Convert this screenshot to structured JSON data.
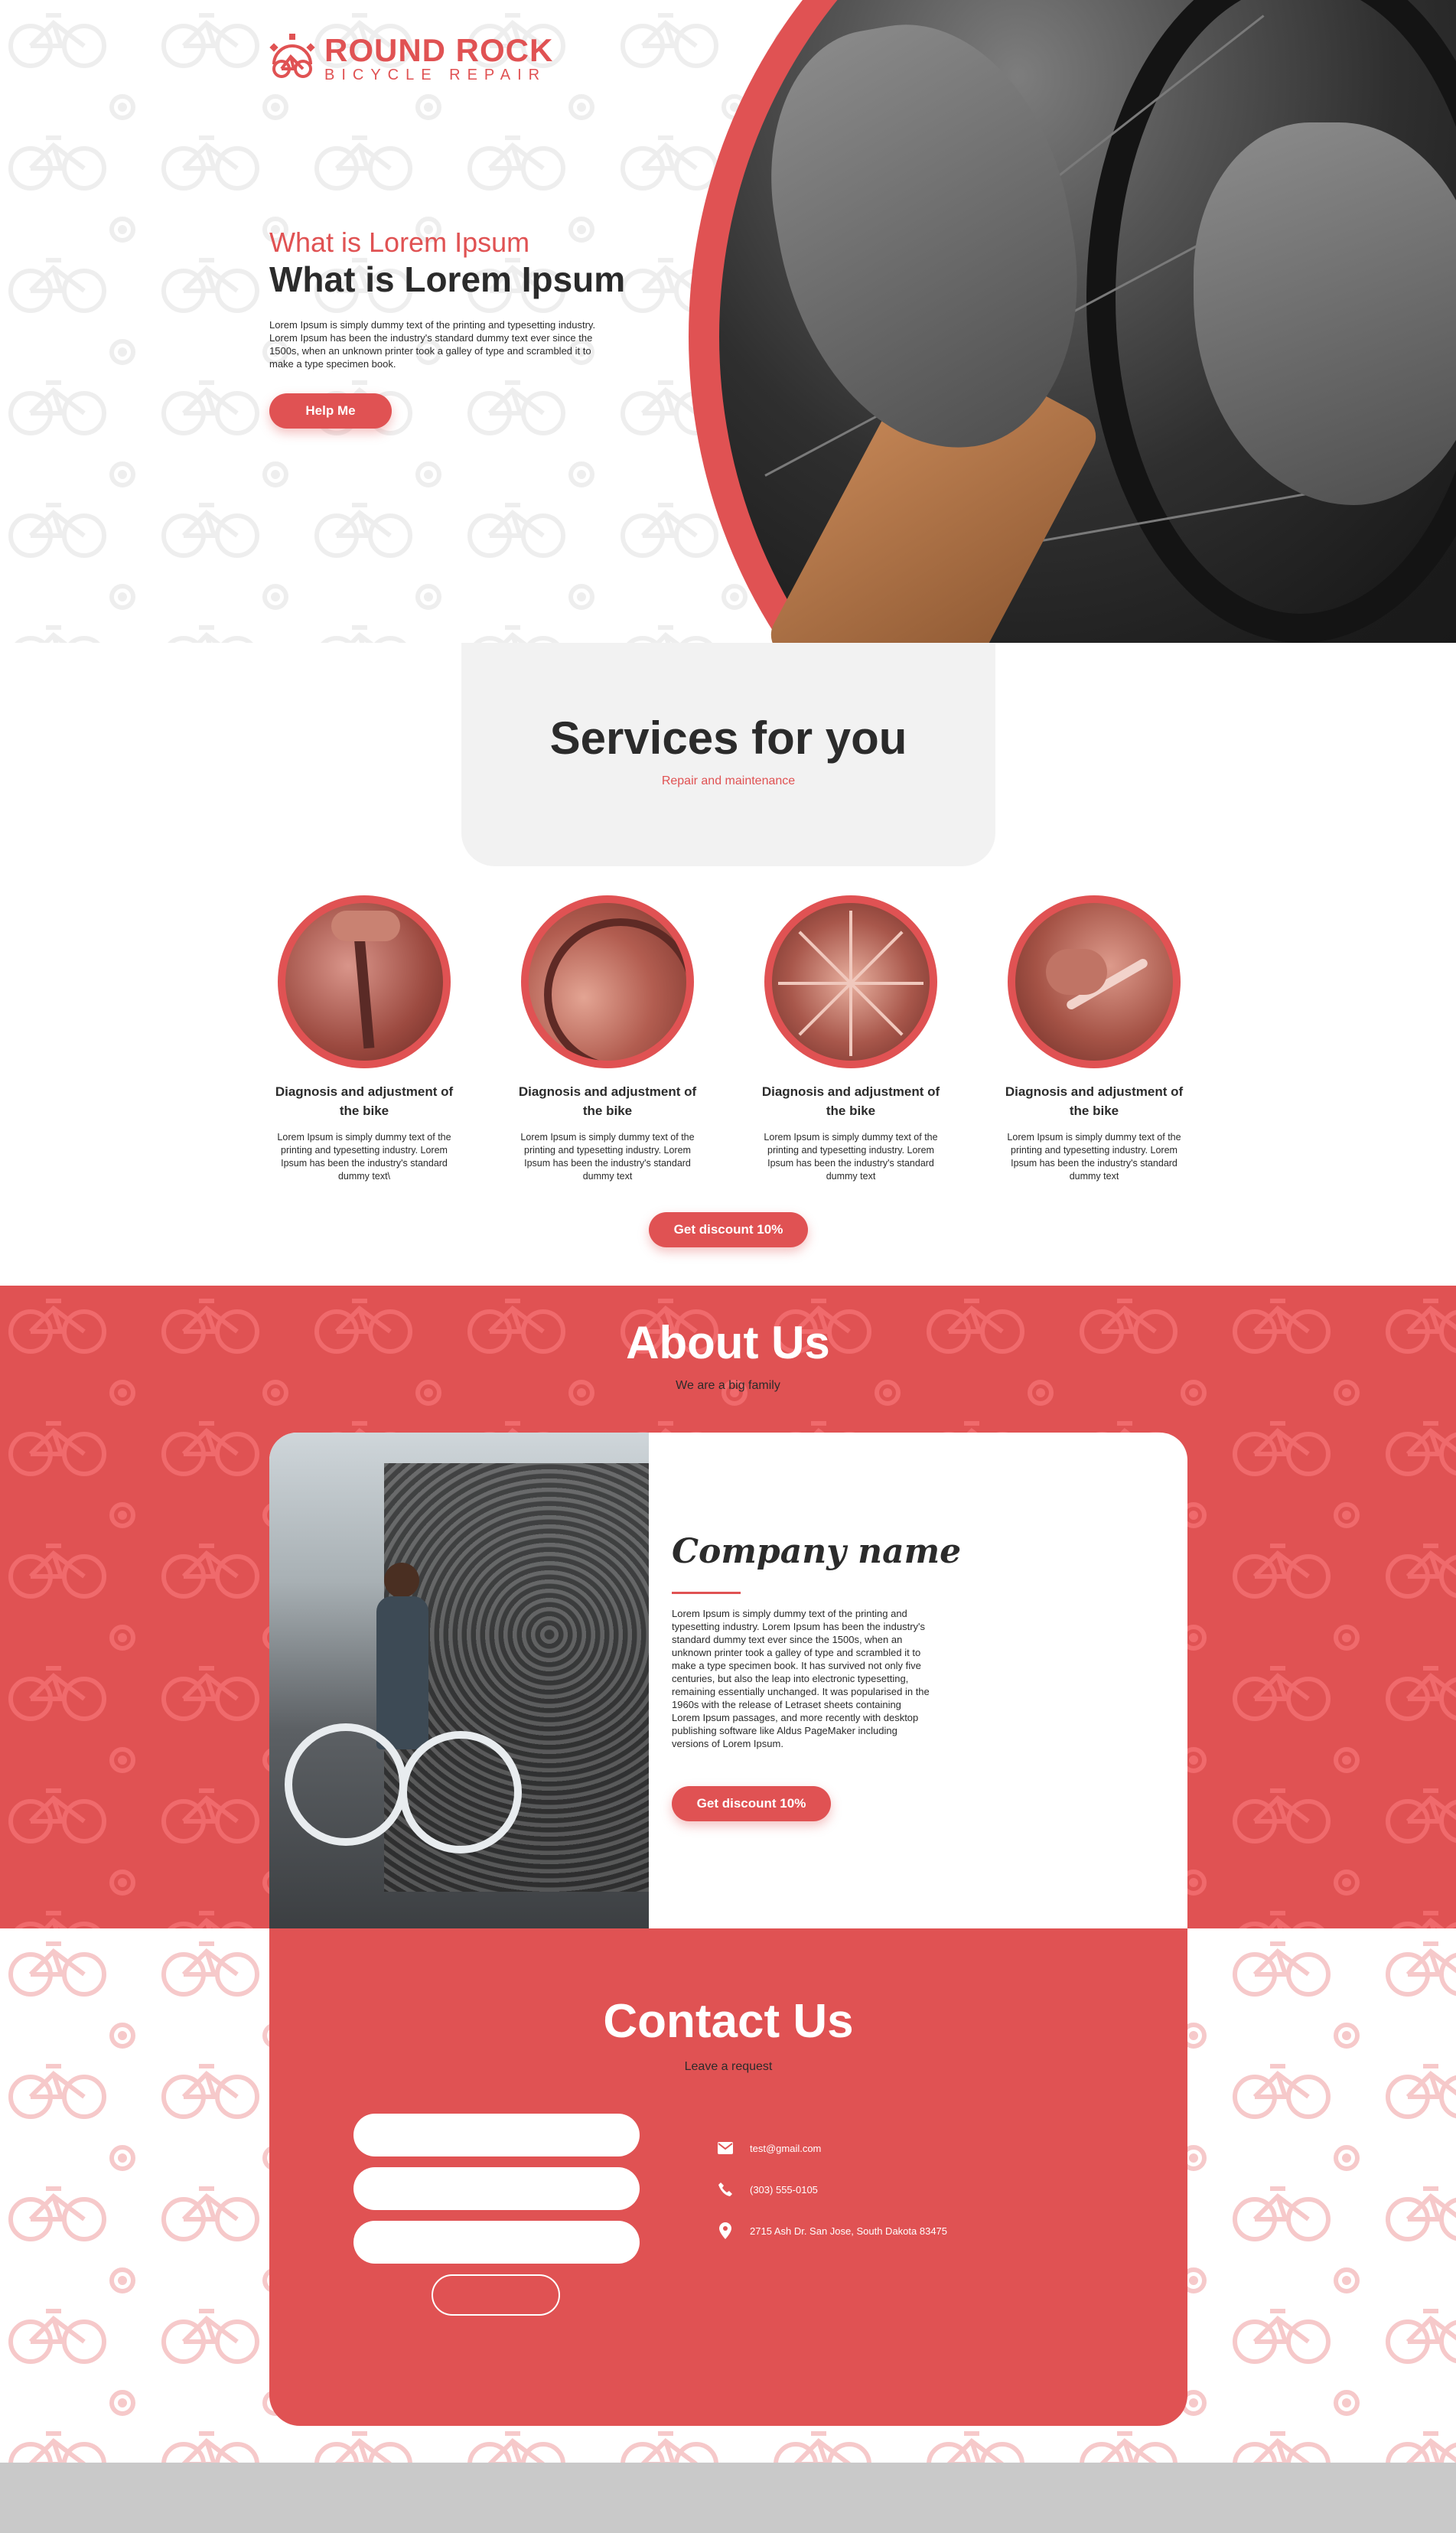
{
  "brand": {
    "title": "ROUND ROCK",
    "subtitle": "BICYCLE REPAIR",
    "color": "#e05253"
  },
  "hero": {
    "kicker": "What is Lorem Ipsum",
    "title": "What is Lorem Ipsum",
    "text": "Lorem Ipsum is simply dummy text of the printing and typesetting industry. Lorem Ipsum has been the industry's standard dummy text ever since the 1500s, when an unknown printer took a galley of type and scrambled it to make a type specimen book.",
    "button": "Help Me"
  },
  "services": {
    "title": "Services for you",
    "subtitle": "Repair and maintenance",
    "items": [
      {
        "title": "Diagnosis and adjustment of the bike",
        "text": "Lorem Ipsum is simply dummy text of the printing and typesetting industry. Lorem Ipsum has been the industry's standard dummy text\\"
      },
      {
        "title": "Diagnosis and adjustment of the bike",
        "text": "Lorem Ipsum is simply dummy text of the printing and typesetting industry. Lorem Ipsum has been the industry's standard dummy text"
      },
      {
        "title": "Diagnosis and adjustment of the bike",
        "text": "Lorem Ipsum is simply dummy text of the printing and typesetting industry. Lorem Ipsum has been the industry's standard dummy text"
      },
      {
        "title": "Diagnosis and adjustment of the bike",
        "text": "Lorem Ipsum is simply dummy text of the printing and typesetting industry. Lorem Ipsum has been the industry's standard dummy text"
      }
    ],
    "button": "Get discount 10%"
  },
  "about": {
    "title": "About Us",
    "subtitle": "We are a big family",
    "company_name": "Company name",
    "text": "Lorem Ipsum is simply dummy text of the printing and typesetting industry. Lorem Ipsum has been the industry's standard dummy text ever since the 1500s, when an unknown printer took a galley of type and scrambled it to make a type specimen book. It has survived not only five centuries, but also the leap into electronic typesetting, remaining essentially unchanged. It was popularised in the 1960s with the release of Letraset sheets containing Lorem Ipsum passages, and more recently with desktop publishing software like Aldus PageMaker including versions of Lorem Ipsum.",
    "button": "Get discount 10%"
  },
  "contact": {
    "title": "Contact Us",
    "subtitle": "Leave a request",
    "fields": [
      "",
      "",
      ""
    ],
    "send_label": "",
    "email": "test@gmail.com",
    "phone": "(303) 555-0105",
    "address": "2715 Ash Dr. San Jose, South Dakota 83475",
    "icons": [
      "mail-icon",
      "phone-icon",
      "location-pin-icon"
    ]
  }
}
